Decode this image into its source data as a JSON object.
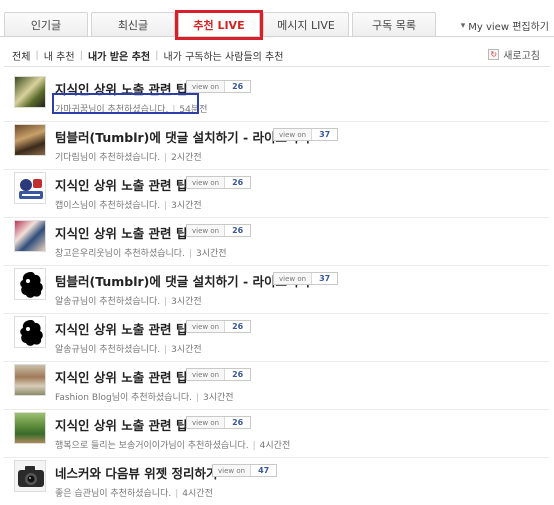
{
  "tabs": [
    {
      "label": "인기글"
    },
    {
      "label": "최신글"
    },
    {
      "label": "추천 LIVE"
    },
    {
      "label": "메시지 LIVE"
    },
    {
      "label": "구독 목록"
    }
  ],
  "my_view": {
    "label": "My view 편집하기"
  },
  "filter": {
    "all": "전체",
    "mine": "내 추천",
    "received": "내가 받은 추천",
    "subscribed": "내가 구독하는 사람들의 추천"
  },
  "refresh_label": "새로고침",
  "view_on_label": "view on",
  "colors": {
    "active_tab": "#d22424",
    "highlight_red": "#d9202a",
    "highlight_blue": "#2c3fa8",
    "count": "#3a5a9a"
  },
  "items": [
    {
      "thumb": "photo",
      "title": "지식인 상위 노출 관련 팁",
      "count": "26",
      "user": "가마귀꿈님이 추천하셨습니다.",
      "time": "54분전"
    },
    {
      "thumb": "photo",
      "title": "텀블러(Tumblr)에 댓글 설치하기 - 라이브러리",
      "count": "37",
      "user": "기다림님이 추천하셨습니다.",
      "time": "2시간전"
    },
    {
      "thumb": "logo",
      "title": "지식인 상위 노출 관련 팁",
      "count": "26",
      "user": "캡이스님이 추천하셨습니다.",
      "time": "3시간전"
    },
    {
      "thumb": "photo",
      "title": "지식인 상위 노출 관련 팁",
      "count": "26",
      "user": "창고은우리웃님이 추천하셨습니다.",
      "time": "3시간전"
    },
    {
      "thumb": "silhouette",
      "title": "텀블러(Tumblr)에 댓글 설치하기 - 라이브러리",
      "count": "37",
      "user": "알송규님이 추천하셨습니다.",
      "time": "3시간전"
    },
    {
      "thumb": "silhouette",
      "title": "지식인 상위 노출 관련 팁",
      "count": "26",
      "user": "알송규님이 추천하셨습니다.",
      "time": "3시간전"
    },
    {
      "thumb": "photo",
      "title": "지식인 상위 노출 관련 팁",
      "count": "26",
      "user": "Fashion Blog님이 추천하셨습니다.",
      "time": "3시간전"
    },
    {
      "thumb": "photo",
      "title": "지식인 상위 노출 관련 팁",
      "count": "26",
      "user": "행복으로 들리는 보송거이이가님이 추천하셨습니다.",
      "time": "4시간전"
    },
    {
      "thumb": "camera",
      "title": "네스커와 다음뷰 위젯 정리하기",
      "count": "47",
      "user": "좋은 습관님이 추천하셨습니다.",
      "time": "4시간전"
    }
  ]
}
